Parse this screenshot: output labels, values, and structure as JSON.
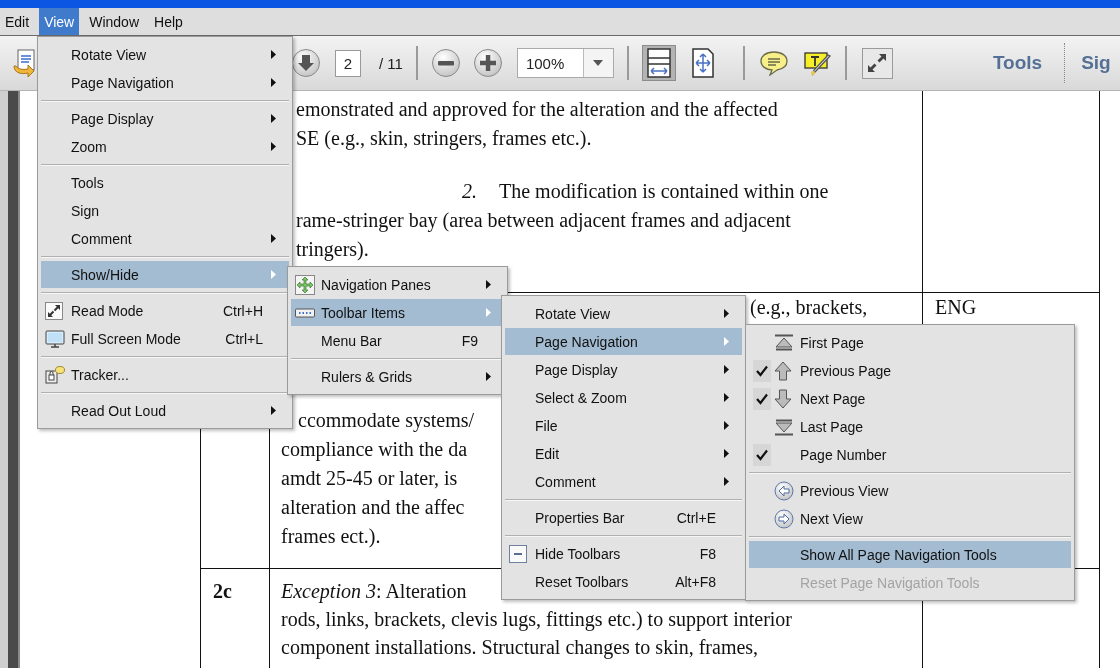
{
  "menubar": {
    "items": [
      {
        "label": "Edit",
        "selected": false
      },
      {
        "label": "View",
        "selected": true
      },
      {
        "label": "Window",
        "selected": false
      },
      {
        "label": "Help",
        "selected": false
      }
    ]
  },
  "toolbar": {
    "page_field": {
      "value": "2"
    },
    "page_total": "/ 11",
    "zoom_field": {
      "value": "100%"
    },
    "view_buttons": [
      {
        "selected": true
      },
      {
        "selected": false
      }
    ],
    "tools_label": "Tools",
    "sign_label": "Sig"
  },
  "document": {
    "row_1": {
      "paragraphs": [
        {
          "lines": [
            "emonstrated and approved for the alteration and the affected",
            "SE (e.g., skin, stringers, frames etc.)."
          ]
        },
        {
          "number": "2.",
          "lines": [
            "The modification is contained within one",
            "rame-stringer bay (area between adjacent frames and adjacent",
            "tringers)."
          ]
        }
      ]
    },
    "row_2": {
      "top_fragment": "(e.g., brackets,",
      "lines": [
        "ccommodate systems/",
        "compliance with the da",
        "amdt 25-45 or later, is",
        "alteration and the affec",
        "frames ect.)."
      ],
      "column_3": "ENG"
    },
    "row_3": {
      "column_1": "2c",
      "lines": [
        "*Exception 3*: Alteration",
        "rods, links, brackets, clevis lugs, fittings etc.) to support interior",
        "component installations. Structural changes to skin, frames,"
      ]
    }
  },
  "menus": [
    {
      "groups": [
        [
          {
            "label": "Rotate View",
            "has_submenu": true,
            "selected": false
          },
          {
            "label": "Page Navigation",
            "has_submenu": true,
            "selected": false
          }
        ],
        [
          {
            "label": "Page Display",
            "has_submenu": true,
            "selected": false
          },
          {
            "label": "Zoom",
            "has_submenu": true,
            "selected": false
          }
        ],
        [
          {
            "label": "Tools",
            "has_submenu": false,
            "selected": false
          },
          {
            "label": "Sign",
            "has_submenu": false,
            "selected": false
          },
          {
            "label": "Comment",
            "has_submenu": true,
            "selected": false
          }
        ],
        [
          {
            "label": "Show/Hide",
            "has_submenu": true,
            "selected": true
          }
        ],
        [
          {
            "label": "Read Mode",
            "shortcut": "Ctrl+H",
            "has_submenu": false,
            "selected": false
          },
          {
            "label": "Full Screen Mode",
            "shortcut": "Ctrl+L",
            "has_submenu": false,
            "selected": false
          }
        ],
        [
          {
            "label": "Tracker...",
            "has_submenu": false,
            "selected": false
          }
        ],
        [
          {
            "label": "Read Out Loud",
            "has_submenu": true,
            "selected": false
          }
        ]
      ]
    },
    {
      "groups": [
        [
          {
            "label": "Navigation Panes",
            "has_submenu": true,
            "selected": false
          },
          {
            "label": "Toolbar Items",
            "has_submenu": true,
            "selected": true
          },
          {
            "label": "Menu Bar",
            "shortcut": "F9",
            "has_submenu": false,
            "selected": false
          }
        ],
        [
          {
            "label": "Rulers & Grids",
            "has_submenu": true,
            "selected": false
          }
        ]
      ]
    },
    {
      "groups": [
        [
          {
            "label": "Rotate View",
            "has_submenu": true,
            "selected": false
          },
          {
            "label": "Page Navigation",
            "has_submenu": true,
            "selected": true
          },
          {
            "label": "Page Display",
            "has_submenu": true,
            "selected": false
          },
          {
            "label": "Select & Zoom",
            "has_submenu": true,
            "selected": false
          },
          {
            "label": "File",
            "has_submenu": true,
            "selected": false
          },
          {
            "label": "Edit",
            "has_submenu": true,
            "selected": false
          },
          {
            "label": "Comment",
            "has_submenu": true,
            "selected": false
          }
        ],
        [
          {
            "label": "Properties Bar",
            "shortcut": "Ctrl+E",
            "has_submenu": false,
            "selected": false
          }
        ],
        [
          {
            "label": "Hide Toolbars",
            "shortcut": "F8",
            "has_submenu": false,
            "selected": false
          },
          {
            "label": "Reset Toolbars",
            "shortcut": "Alt+F8",
            "has_submenu": false,
            "selected": false
          }
        ]
      ]
    },
    {
      "groups": [
        [
          {
            "label": "First Page",
            "checked": false,
            "disabled": false,
            "selected": false
          },
          {
            "label": "Previous Page",
            "checked": true,
            "disabled": false,
            "selected": false
          },
          {
            "label": "Next Page",
            "checked": true,
            "disabled": false,
            "selected": false
          },
          {
            "label": "Last Page",
            "checked": false,
            "disabled": false,
            "selected": false
          },
          {
            "label": "Page Number",
            "checked": true,
            "disabled": false,
            "selected": false
          }
        ],
        [
          {
            "label": "Previous View",
            "checked": false,
            "disabled": false,
            "selected": false
          },
          {
            "label": "Next View",
            "checked": false,
            "disabled": false,
            "selected": false
          }
        ],
        [
          {
            "label": "Show All Page Navigation Tools",
            "checked": false,
            "disabled": false,
            "selected": true
          },
          {
            "label": "Reset Page Navigation Tools",
            "checked": false,
            "disabled": true,
            "selected": false
          }
        ]
      ]
    }
  ]
}
